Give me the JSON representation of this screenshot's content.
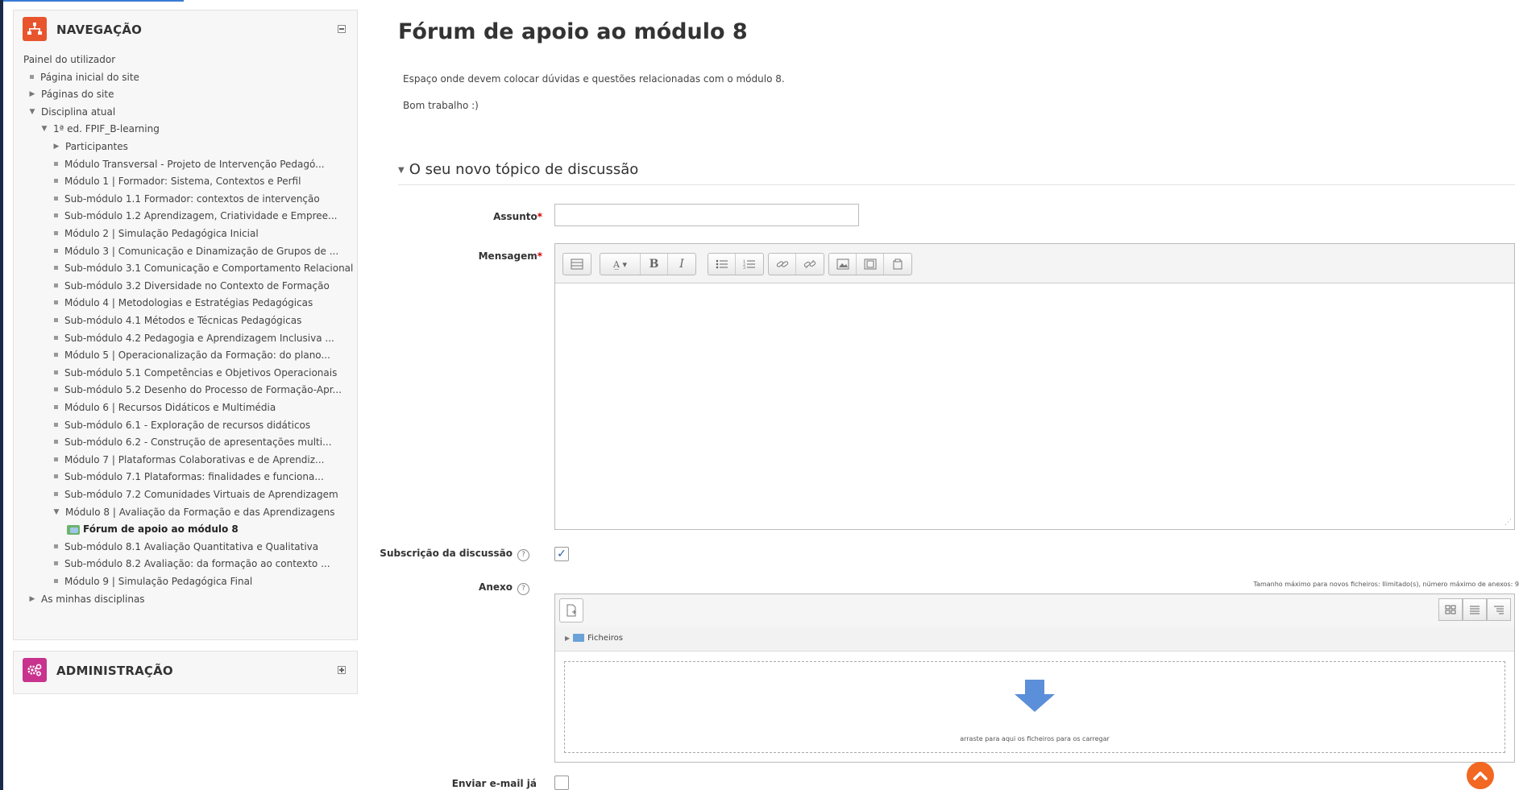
{
  "navigation": {
    "title": "NAVEGAÇÃO",
    "items": [
      {
        "label": "Painel do utilizador",
        "type": "plain",
        "indent": 0
      },
      {
        "label": "Página inicial do site",
        "type": "leaf",
        "indent": 0
      },
      {
        "label": "Páginas do site",
        "type": "collapsed",
        "indent": 0
      },
      {
        "label": "Disciplina atual",
        "type": "expanded",
        "indent": 0
      },
      {
        "label": "1ª ed. FPIF_B-learning",
        "type": "expanded",
        "indent": 1
      },
      {
        "label": "Participantes",
        "type": "collapsed",
        "indent": 2
      },
      {
        "label": "Módulo Transversal - Projeto de Intervenção Pedagó...",
        "type": "leaf",
        "indent": 2
      },
      {
        "label": "Módulo 1 | Formador: Sistema, Contextos e Perfil",
        "type": "leaf",
        "indent": 2
      },
      {
        "label": "Sub-módulo 1.1 Formador: contextos de intervenção",
        "type": "leaf",
        "indent": 2
      },
      {
        "label": "Sub-módulo 1.2 Aprendizagem, Criatividade e Empree...",
        "type": "leaf",
        "indent": 2
      },
      {
        "label": "Módulo 2 | Simulação Pedagógica Inicial",
        "type": "leaf",
        "indent": 2
      },
      {
        "label": "Módulo 3 | Comunicação e Dinamização de Grupos de ...",
        "type": "leaf",
        "indent": 2
      },
      {
        "label": "Sub-módulo 3.1 Comunicação e Comportamento Relacional",
        "type": "leaf",
        "indent": 2
      },
      {
        "label": "Sub-módulo 3.2 Diversidade no Contexto de Formação",
        "type": "leaf",
        "indent": 2
      },
      {
        "label": "Módulo 4 | Metodologias e Estratégias Pedagógicas",
        "type": "leaf",
        "indent": 2
      },
      {
        "label": "Sub-módulo 4.1 Métodos e Técnicas Pedagógicas",
        "type": "leaf",
        "indent": 2
      },
      {
        "label": "Sub-módulo 4.2 Pedagogia e Aprendizagem Inclusiva ...",
        "type": "leaf",
        "indent": 2
      },
      {
        "label": "Módulo 5 | Operacionalização da Formação: do plano...",
        "type": "leaf",
        "indent": 2
      },
      {
        "label": "Sub-módulo 5.1 Competências e Objetivos Operacionais",
        "type": "leaf",
        "indent": 2
      },
      {
        "label": "Sub-módulo 5.2 Desenho do Processo de Formação-Apr...",
        "type": "leaf",
        "indent": 2
      },
      {
        "label": "Módulo 6 | Recursos Didáticos e Multimédia",
        "type": "leaf",
        "indent": 2
      },
      {
        "label": "Sub-módulo 6.1 - Exploração de recursos didáticos",
        "type": "leaf",
        "indent": 2
      },
      {
        "label": "Sub-módulo 6.2 - Construção de apresentações multi...",
        "type": "leaf",
        "indent": 2
      },
      {
        "label": "Módulo 7 | Plataformas Colaborativas e de Aprendiz...",
        "type": "leaf",
        "indent": 2
      },
      {
        "label": "Sub-módulo 7.1 Plataformas: finalidades e funciona...",
        "type": "leaf",
        "indent": 2
      },
      {
        "label": "Sub-módulo 7.2 Comunidades Virtuais de Aprendizagem",
        "type": "leaf",
        "indent": 2
      },
      {
        "label": "Módulo 8 | Avaliação da Formação e das Aprendizagens",
        "type": "expanded",
        "indent": 2
      },
      {
        "label": "Fórum de apoio ao módulo 8",
        "type": "forum",
        "indent": 3
      },
      {
        "label": "Sub-módulo 8.1 Avaliação Quantitativa e Qualitativa",
        "type": "leaf",
        "indent": 2
      },
      {
        "label": "Sub-módulo 8.2 Avaliação: da formação ao contexto ...",
        "type": "leaf",
        "indent": 2
      },
      {
        "label": "Módulo 9 | Simulação Pedagógica Final",
        "type": "leaf",
        "indent": 2
      },
      {
        "label": "As minhas disciplinas",
        "type": "collapsed",
        "indent": 0
      }
    ]
  },
  "administration": {
    "title": "ADMINISTRAÇÃO"
  },
  "page": {
    "title": "Fórum de apoio ao módulo 8",
    "intro": [
      "Espaço onde devem colocar dúvidas e questões relacionadas com o módulo 8.",
      "Bom trabalho :)"
    ],
    "section_title": "O seu novo tópico de discussão"
  },
  "form": {
    "subject_label": "Assunto",
    "message_label": "Mensagem",
    "subject_value": "",
    "required_mark": "*",
    "subscription_label": "Subscrição da discussão",
    "subscription_checked": true,
    "attachment_label": "Anexo",
    "attachment_note": "Tamanho máximo para novos ficheiros: Ilimitado(s), número máximo de anexos: 9",
    "files_folder": "Ficheiros",
    "drop_text": "arraste para aqui os ficheiros para os carregar",
    "mail_now_label": "Enviar e-mail já",
    "mail_now_checked": false,
    "help_glyph": "?"
  },
  "colors": {
    "nav_icon": "#e8552d",
    "admin_icon": "#c8338d",
    "back_to_top": "#f26722",
    "drop_arrow": "#5b8fd9"
  }
}
